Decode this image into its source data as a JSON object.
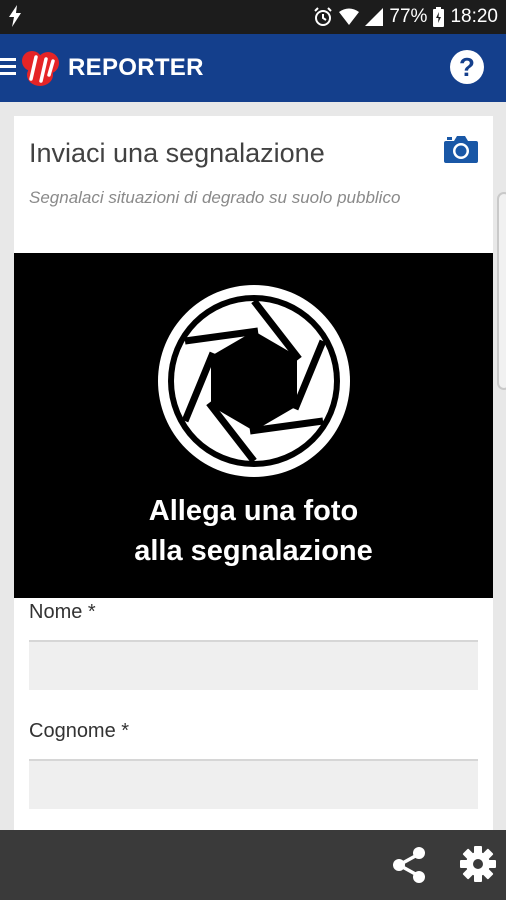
{
  "status_bar": {
    "battery_percent": "77%",
    "time": "18:20",
    "icons": [
      "flash-icon",
      "alarm-icon",
      "wifi-icon",
      "signal-icon",
      "battery-icon"
    ]
  },
  "app_bar": {
    "title": "REPORTER",
    "icons": [
      "menu-icon",
      "logo-icon",
      "help-icon"
    ]
  },
  "card": {
    "title": "Inviaci una segnalazione",
    "subtitle": "Segnalaci situazioni di degrado su suolo pubblico",
    "camera_icon": "camera-icon"
  },
  "photo": {
    "label_line1": "Allega una foto",
    "label_line2": "alla segnalazione",
    "icon": "aperture-icon"
  },
  "form": {
    "fields": [
      {
        "label": "Nome *",
        "value": "",
        "placeholder": ""
      },
      {
        "label": "Cognome *",
        "value": "",
        "placeholder": ""
      }
    ]
  },
  "bottom_bar": {
    "icons": [
      "share-icon",
      "settings-icon"
    ]
  },
  "colors": {
    "app_bar": "#143f8c",
    "status_bar": "#1c1c1c",
    "bottom_bar": "#3a3a3a",
    "accent": "#1957a6"
  }
}
